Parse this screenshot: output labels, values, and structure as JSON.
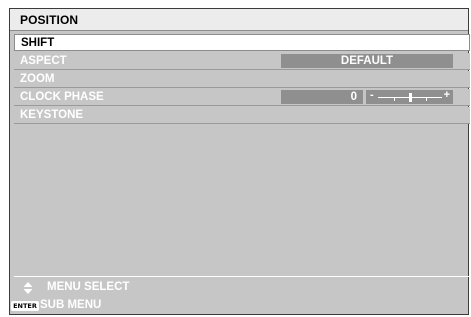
{
  "menu": {
    "title": "POSITION",
    "items": [
      {
        "label": "SHIFT",
        "value": ""
      },
      {
        "label": "ASPECT",
        "value": "DEFAULT"
      },
      {
        "label": "ZOOM",
        "value": ""
      },
      {
        "label": "CLOCK PHASE",
        "value": "0"
      },
      {
        "label": "KEYSTONE",
        "value": ""
      }
    ],
    "selected_item": "SHIFT",
    "clock_phase_slider": {
      "minus_symbol": "-",
      "plus_symbol": "+",
      "level": 0.5
    }
  },
  "footer": {
    "menu_select_icon": "up-down-arrow-icon",
    "menu_select_label": "MENU SELECT",
    "enter_badge": "ENTER",
    "sub_menu_label": "SUB MENU"
  },
  "colors": {
    "panel": "#c6c6c6",
    "title_bar": "#ececec",
    "selected_row": "#ffffff",
    "value_box": "#8f8f8f"
  }
}
